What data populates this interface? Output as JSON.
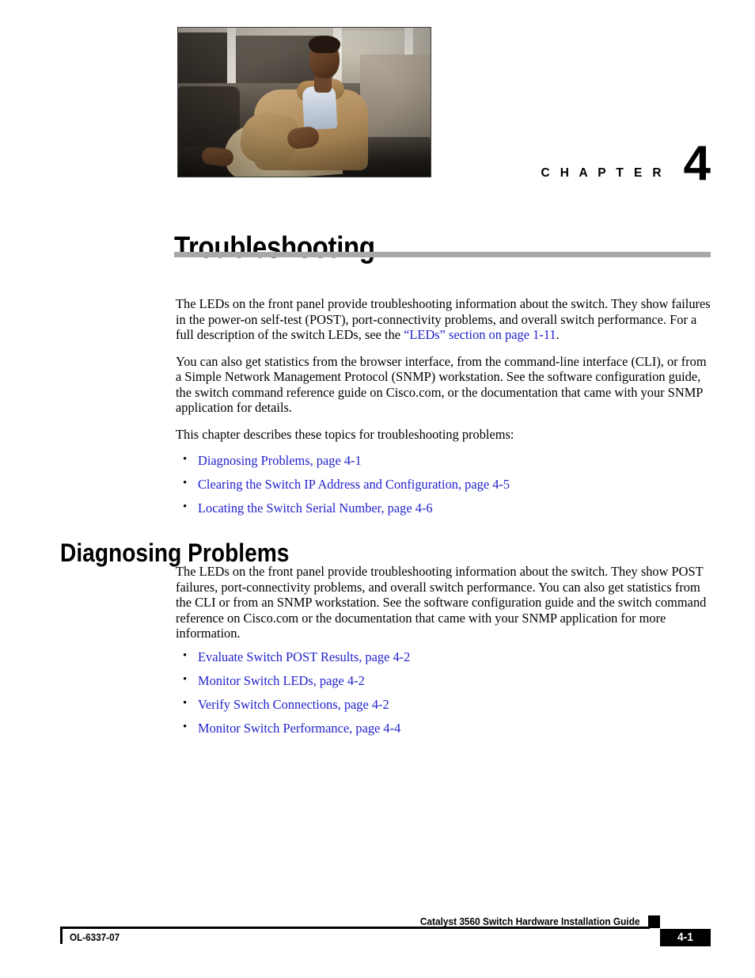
{
  "chapter": {
    "label": "C H A P T E R",
    "number": "4",
    "title": "Troubleshooting",
    "photo_alt": "seated-man-in-tan-jacket-office-lobby"
  },
  "intro": {
    "paragraph_1_before_link": "The LEDs on the front panel provide troubleshooting information about the switch. They show failures in the power-on self-test (POST), port-connectivity problems, and overall switch performance. For a full description of the switch LEDs, see the ",
    "paragraph_1_link": "“LEDs” section on page 1-11",
    "paragraph_1_after_link": ".",
    "paragraph_2": "You can also get statistics from the browser interface, from the command-line interface (CLI), or from a Simple Network Management Protocol (SNMP) workstation. See the software configuration guide, the switch command reference guide on Cisco.com, or the documentation that came with your SNMP application for details.",
    "paragraph_3": "This chapter describes these topics for troubleshooting problems:",
    "links": [
      "Diagnosing Problems, page 4-1",
      "Clearing the Switch IP Address and Configuration, page 4-5",
      "Locating the Switch Serial Number, page 4-6"
    ]
  },
  "section": {
    "heading": "Diagnosing Problems",
    "paragraph_1": "The LEDs on the front panel provide troubleshooting information about the switch. They show POST failures, port-connectivity problems, and overall switch performance. You can also get statistics from the CLI or from an SNMP workstation. See the software configuration guide and the switch command reference on Cisco.com or the documentation that came with your SNMP application for more information.",
    "links": [
      "Evaluate Switch POST Results, page 4-2",
      "Monitor Switch LEDs, page 4-2",
      "Verify Switch Connections, page 4-2",
      "Monitor Switch Performance, page 4-4"
    ]
  },
  "footer": {
    "guide_title": "Catalyst 3560 Switch Hardware Installation Guide",
    "document_number": "OL-6337-07",
    "page_number": "4-1"
  },
  "colors": {
    "link": "#2222cc",
    "title_rule": "#a8a8a8",
    "footer_black": "#000000"
  }
}
